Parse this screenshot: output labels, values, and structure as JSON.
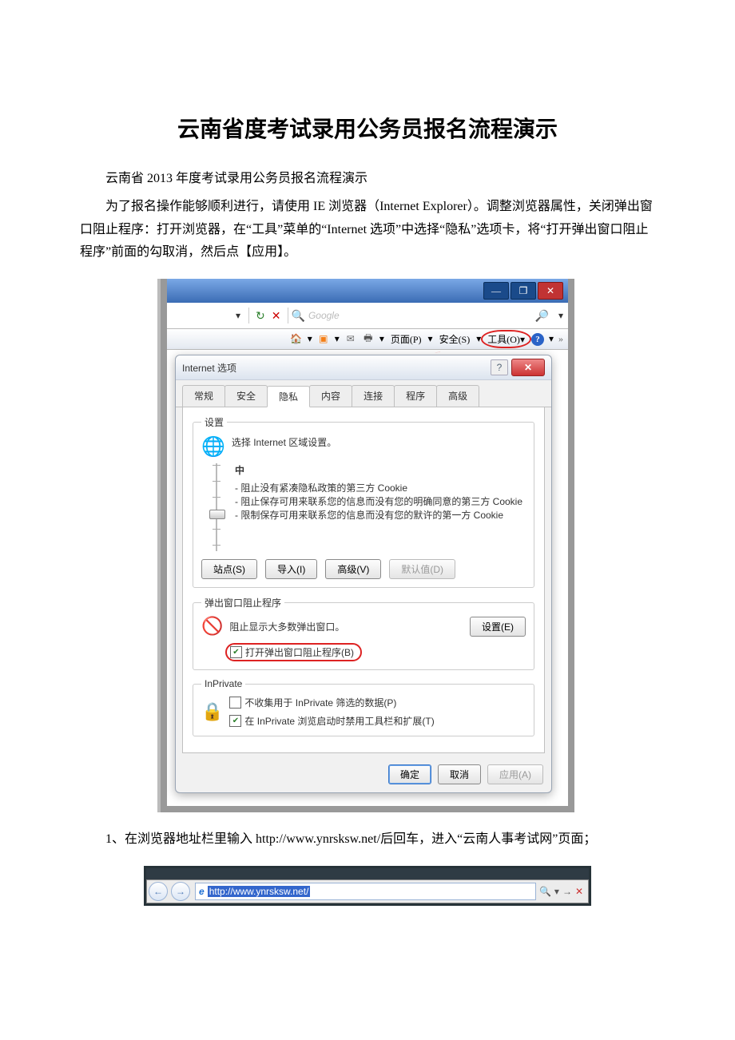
{
  "title": "云南省度考试录用公务员报名流程演示",
  "para1": "云南省 2013 年度考试录用公务员报名流程演示",
  "para2": "为了报名操作能够顺利进行，请使用 IE 浏览器（Internet Explorer）。调整浏览器属性，关闭弹出窗口阻止程序：打开浏览器，在“工具”菜单的“Internet 选项”中选择“隐私”选项卡，将“打开弹出窗口阻止程序”前面的勾取消，然后点【应用】。",
  "para3": "1、在浏览器地址栏里输入 http://www.ynrsksw.net/后回车，进入“云南人事考试网”页面；",
  "ie": {
    "searchPlaceholder": "Google",
    "toolbar": {
      "page": "页面(P)",
      "safety": "安全(S)",
      "tools": "工具(O)"
    }
  },
  "dialog": {
    "title": "Internet 选项",
    "tabs": [
      "常规",
      "安全",
      "隐私",
      "内容",
      "连接",
      "程序",
      "高级"
    ],
    "settings": {
      "legend": "设置",
      "desc": "选择 Internet 区域设置。",
      "level": "中",
      "b1": "- 阻止没有紧凑隐私政策的第三方 Cookie",
      "b2": "- 阻止保存可用来联系您的信息而没有您的明确同意的第三方 Cookie",
      "b3": "- 限制保存可用来联系您的信息而没有您的默许的第一方 Cookie",
      "btnSites": "站点(S)",
      "btnImport": "导入(I)",
      "btnAdvanced": "高级(V)",
      "btnDefault": "默认值(D)"
    },
    "popup": {
      "legend": "弹出窗口阻止程序",
      "desc": "阻止显示大多数弹出窗口。",
      "btnSettings": "设置(E)",
      "chk": "打开弹出窗口阻止程序(B)"
    },
    "inprivate": {
      "legend": "InPrivate",
      "chk1": "不收集用于 InPrivate 筛选的数据(P)",
      "chk2": "在 InPrivate 浏览启动时禁用工具栏和扩展(T)"
    },
    "ok": "确定",
    "cancel": "取消",
    "apply": "应用(A)"
  },
  "addressbar": {
    "url": "http://www.ynrsksw.net/"
  }
}
